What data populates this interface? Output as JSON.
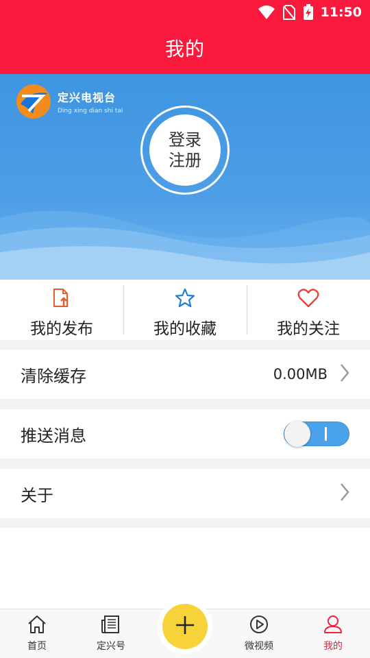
{
  "status_bar": {
    "time": "11:50",
    "icons": [
      "wifi-icon",
      "no-sim-icon",
      "battery-charging-icon"
    ]
  },
  "header": {
    "title": "我的"
  },
  "banner": {
    "logo": {
      "name": "定兴电视台",
      "pinyin": "Ding xing dian shi tai"
    },
    "login": {
      "line1": "登录",
      "line2": "注册"
    }
  },
  "quick_actions": [
    {
      "label": "我的发布",
      "icon": "publish-icon",
      "color": "#f05a28"
    },
    {
      "label": "我的收藏",
      "icon": "star-icon",
      "color": "#1e7fd8"
    },
    {
      "label": "我的关注",
      "icon": "heart-icon",
      "color": "#e8413a"
    }
  ],
  "settings": {
    "clear_cache": {
      "label": "清除缓存",
      "value": "0.00MB"
    },
    "push": {
      "label": "推送消息",
      "enabled": true
    },
    "about": {
      "label": "关于"
    }
  },
  "bottom_nav": [
    {
      "label": "首页",
      "icon": "home-icon",
      "active": false
    },
    {
      "label": "定兴号",
      "icon": "newspaper-icon",
      "active": false
    },
    {
      "label": "微视频",
      "icon": "play-icon",
      "active": false
    },
    {
      "label": "我的",
      "icon": "user-icon",
      "active": true
    }
  ],
  "fab": {
    "icon": "plus-icon"
  },
  "colors": {
    "header": "#f8193c",
    "banner": "#4d9ee6",
    "active": "#f0203f",
    "fab": "#f7d33a"
  }
}
